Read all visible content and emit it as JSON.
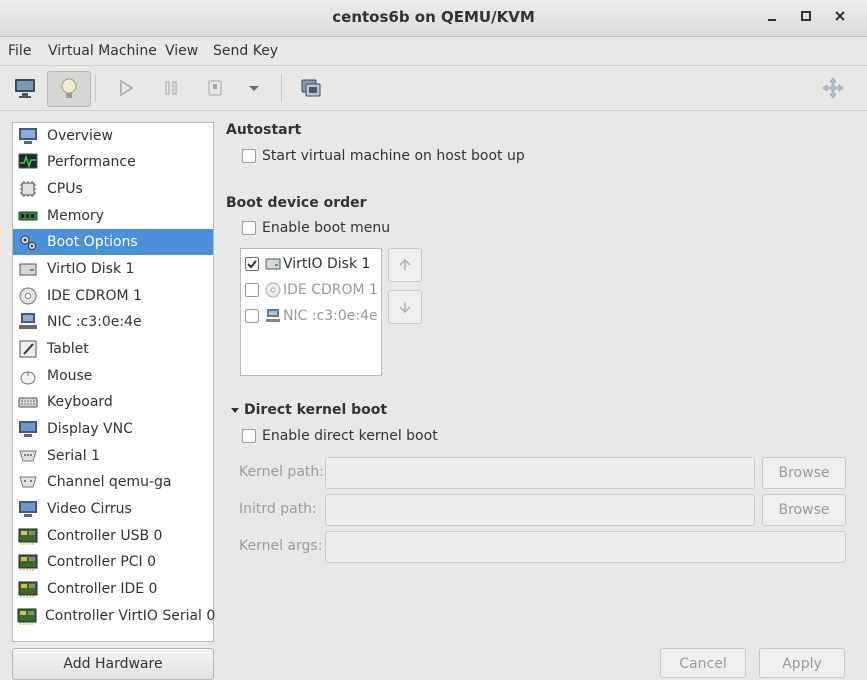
{
  "window": {
    "title": "centos6b on QEMU/KVM",
    "minimize": "_",
    "maximize": "□",
    "close": "×"
  },
  "menubar": {
    "file": "File",
    "vm": "Virtual Machine",
    "view": "View",
    "send_key": "Send Key"
  },
  "toolbar": {
    "icons": [
      "monitor-icon",
      "lightbulb-icon",
      "play-icon",
      "pause-icon",
      "shutdown-icon",
      "dropdown-arrow-icon",
      "snapshot-icon",
      "fullscreen-move-icon"
    ]
  },
  "sidebar": {
    "items": [
      {
        "label": "Overview",
        "icon": "overview-icon"
      },
      {
        "label": "Performance",
        "icon": "performance-icon"
      },
      {
        "label": "CPUs",
        "icon": "cpu-icon"
      },
      {
        "label": "Memory",
        "icon": "memory-icon"
      },
      {
        "label": "Boot Options",
        "icon": "boot-options-icon"
      },
      {
        "label": "VirtIO Disk 1",
        "icon": "disk-icon"
      },
      {
        "label": "IDE CDROM 1",
        "icon": "cdrom-icon"
      },
      {
        "label": "NIC :c3:0e:4e",
        "icon": "nic-icon"
      },
      {
        "label": "Tablet",
        "icon": "tablet-icon"
      },
      {
        "label": "Mouse",
        "icon": "mouse-icon"
      },
      {
        "label": "Keyboard",
        "icon": "keyboard-icon"
      },
      {
        "label": "Display VNC",
        "icon": "display-icon"
      },
      {
        "label": "Serial 1",
        "icon": "serial-icon"
      },
      {
        "label": "Channel qemu-ga",
        "icon": "channel-icon"
      },
      {
        "label": "Video Cirrus",
        "icon": "video-icon"
      },
      {
        "label": "Controller USB 0",
        "icon": "controller-icon"
      },
      {
        "label": "Controller PCI 0",
        "icon": "controller-icon"
      },
      {
        "label": "Controller IDE 0",
        "icon": "controller-icon"
      },
      {
        "label": "Controller VirtIO Serial 0",
        "icon": "controller-icon"
      }
    ],
    "selected": "Boot Options",
    "add_hardware": "Add Hardware"
  },
  "main": {
    "autostart": {
      "heading": "Autostart",
      "checkbox_label": "Start virtual machine on host boot up",
      "checked": false
    },
    "boot_order": {
      "heading": "Boot device order",
      "menu_label": "Enable boot menu",
      "menu_checked": false,
      "devices": [
        {
          "label": "VirtIO Disk 1",
          "checked": true
        },
        {
          "label": "IDE CDROM 1",
          "checked": false
        },
        {
          "label": "NIC :c3:0e:4e",
          "checked": false
        }
      ]
    },
    "kernel": {
      "heading": "Direct kernel boot",
      "enable_label": "Enable direct kernel boot",
      "enabled": false,
      "kernel_path_label": "Kernel path:",
      "initrd_path_label": "Initrd path:",
      "kernel_args_label": "Kernel args:",
      "browse_label": "Browse"
    }
  },
  "footer": {
    "cancel": "Cancel",
    "apply": "Apply"
  },
  "colors": {
    "selection": "#4a90d9",
    "window_bg": "#e8e8e7"
  }
}
